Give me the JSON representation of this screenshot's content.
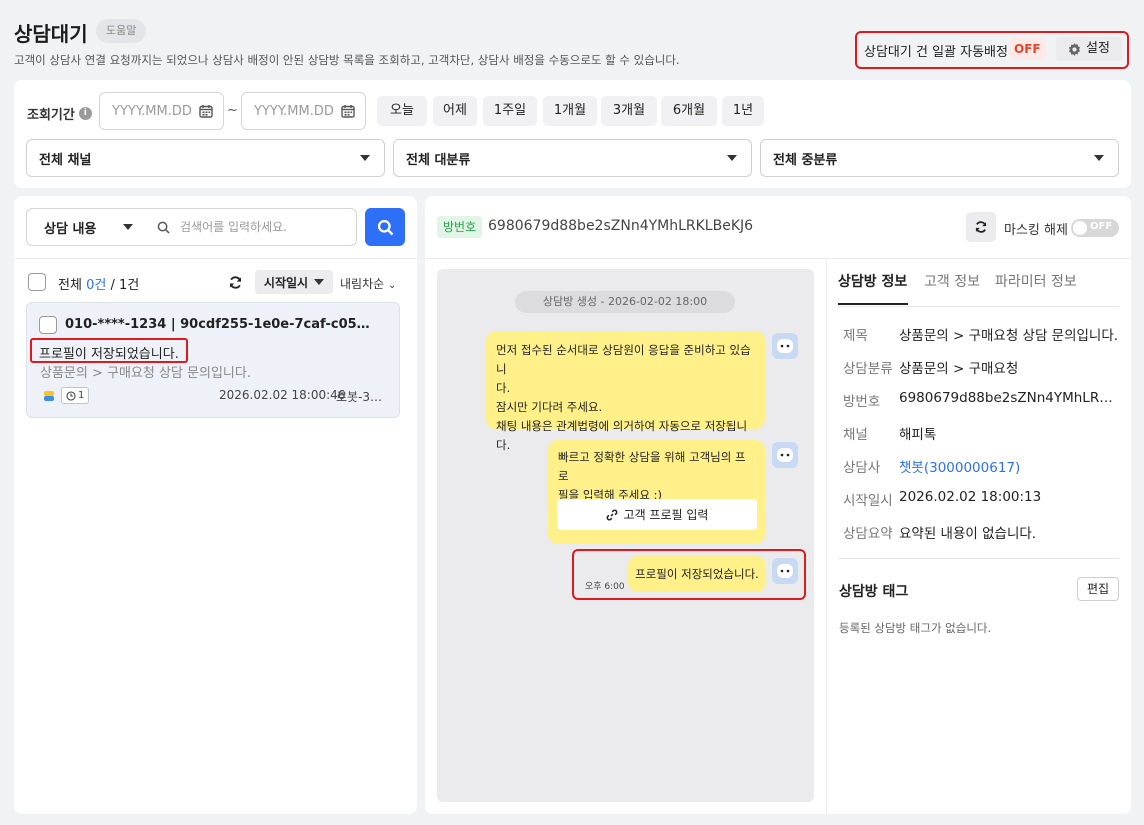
{
  "header": {
    "title": "상담대기",
    "help_label": "도움말",
    "description": "고객이 상담사 연결 요청까지는 되었으나 상담사 배정이 안된 상담방 목록을 조회하고, 고객차단, 상담사 배정을 수동으로도 할 수 있습니다.",
    "auto_assign_label": "상담대기 건 일괄 자동배정",
    "auto_assign_status": "OFF",
    "settings_label": "설정"
  },
  "filters": {
    "period_label": "조회기간",
    "date_placeholder_start": "YYYY.MM.DD",
    "date_placeholder_end": "YYYY.MM.DD",
    "separator": "~",
    "presets": [
      "오늘",
      "어제",
      "1주일",
      "1개월",
      "3개월",
      "6개월",
      "1년"
    ],
    "channel": "전체 채널",
    "major_category": "전체 대분류",
    "minor_category": "전체 중분류"
  },
  "list": {
    "search_type": "상담 내용",
    "search_placeholder": "검색어를 입력하세요.",
    "total_label": "전체",
    "selected_count": "0건",
    "total_count": "/ 1건",
    "sort_field": "시작일시",
    "sort_order": "내림차순",
    "tickets": [
      {
        "title": "010-****-1234 | 90cdf255-1e0e-7caf-c05b-0f2...",
        "last_message": "프로필이 저장되었습니다.",
        "subject": "상품문의 > 구매요청 상담 문의입니다.",
        "wait_count": "1",
        "time": "2026.02.02 18:00:46",
        "agent": "로봇-30..."
      }
    ]
  },
  "room": {
    "room_label": "방번호",
    "room_id": "6980679d88be2sZNn4YMhLRKLBeKJ6",
    "mask_label": "마스킹 해제",
    "mask_status": "OFF"
  },
  "chat": {
    "system_notice": "상담방 생성 - 2026-02-02 18:00",
    "messages": [
      {
        "lines": [
          "먼저 접수된 순서대로 상담원이 응답을 준비하고 있습니",
          "다.",
          "잠시만 기다려 주세요.",
          "채팅 내용은 관계법령에 의거하여 자동으로 저장됩니다."
        ]
      },
      {
        "lines": [
          "빠르고 정확한 상담을 위해 고객님의 프로",
          "필을 입력해 주세요 :)"
        ],
        "button": "고객 프로필 입력"
      },
      {
        "lines": [
          "프로필이 저장되었습니다."
        ],
        "time": "오후 6:00"
      }
    ]
  },
  "info": {
    "tabs": [
      "상담방 정보",
      "고객 정보",
      "파라미터 정보"
    ],
    "fields": [
      {
        "label": "제목",
        "value": "상품문의 > 구매요청 상담 문의입니다."
      },
      {
        "label": "상담분류",
        "value": "상품문의 > 구매요청"
      },
      {
        "label": "방번호",
        "value": "6980679d88be2sZNn4YMhLRKL..."
      },
      {
        "label": "채널",
        "value": "해피톡"
      },
      {
        "label": "상담사",
        "value": "챗봇(3000000617)"
      },
      {
        "label": "시작일시",
        "value": "2026.02.02 18:00:13"
      },
      {
        "label": "상담요약",
        "value": "요약된 내용이 없습니다."
      }
    ],
    "tag_title": "상담방 태그",
    "edit_label": "편집",
    "tag_empty": "등록된 상담방 태그가 없습니다."
  },
  "colors": {
    "primary": "#2d6ff7",
    "highlight_border": "#e0191f",
    "bubble": "#fff08a",
    "room_chip": "#27a447",
    "off": "#e8442a"
  }
}
